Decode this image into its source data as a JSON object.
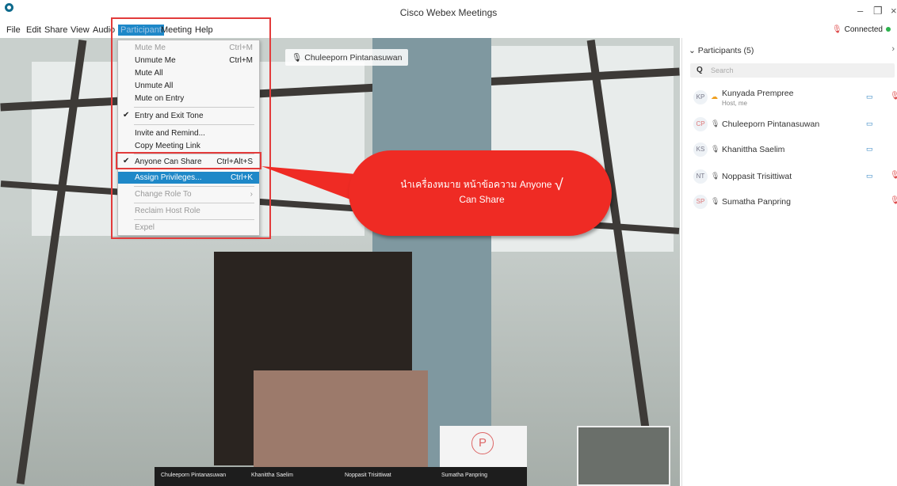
{
  "window": {
    "title": "Cisco Webex Meetings"
  },
  "menubar": {
    "items": [
      "File",
      "Edit",
      "Share",
      "View",
      "Audio",
      "Participant",
      "Meeting",
      "Help"
    ],
    "status": "Connected"
  },
  "video": {
    "active_speaker": "Chuleeporn Pintanasuwan",
    "thumbnails": [
      "Chuleeporn Pintanasuwan",
      "Khanittha Saelim",
      "Noppasit Trisittiwat",
      "Sumatha Panpring"
    ],
    "tile_initial": "P"
  },
  "dropdown": {
    "items": [
      {
        "label": "Mute Me",
        "shortcut": "Ctrl+M",
        "disabled": true
      },
      {
        "label": "Unmute Me",
        "shortcut": "Ctrl+M"
      },
      {
        "label": "Mute All",
        "shortcut": ""
      },
      {
        "label": "Unmute All",
        "shortcut": ""
      },
      {
        "label": "Mute on Entry",
        "shortcut": ""
      },
      {
        "label": "Entry and Exit Tone",
        "shortcut": "",
        "checked": true
      },
      {
        "label": "Invite and Remind...",
        "shortcut": ""
      },
      {
        "label": "Copy Meeting Link",
        "shortcut": ""
      },
      {
        "label": "Anyone Can Share",
        "shortcut": "Ctrl+Alt+S",
        "checked": true
      },
      {
        "label": "Assign Privileges...",
        "shortcut": "Ctrl+K",
        "selected": true
      },
      {
        "label": "Change Role To",
        "shortcut": "›",
        "disabled": true
      },
      {
        "label": "Reclaim Host Role",
        "shortcut": "",
        "disabled": true
      },
      {
        "label": "Expel",
        "shortcut": "",
        "disabled": true
      }
    ]
  },
  "callout": {
    "line1": "นำเครื่องหมาย หน้าข้อความ  Anyone",
    "line2": "Can Share",
    "checkmark": "√"
  },
  "participants": {
    "header": "Participants (5)",
    "search_placeholder": "Search",
    "list": [
      {
        "initials": "KP",
        "name": "Kunyada Prempree",
        "sub": "Host, me",
        "video": true,
        "muted": true
      },
      {
        "initials": "CP",
        "name": "Chuleeporn Pintanasuwan",
        "video": true,
        "muted": false
      },
      {
        "initials": "KS",
        "name": "Khanittha Saelim",
        "video": true,
        "muted": false
      },
      {
        "initials": "NT",
        "name": "Noppasit Trisittiwat",
        "video": true,
        "muted": true
      },
      {
        "initials": "SP",
        "name": "Sumatha Panpring",
        "video": false,
        "muted": true
      }
    ]
  },
  "colors": {
    "accent": "#1e88c8",
    "highlight": "#e23b3b",
    "callout": "#ef2b24"
  }
}
